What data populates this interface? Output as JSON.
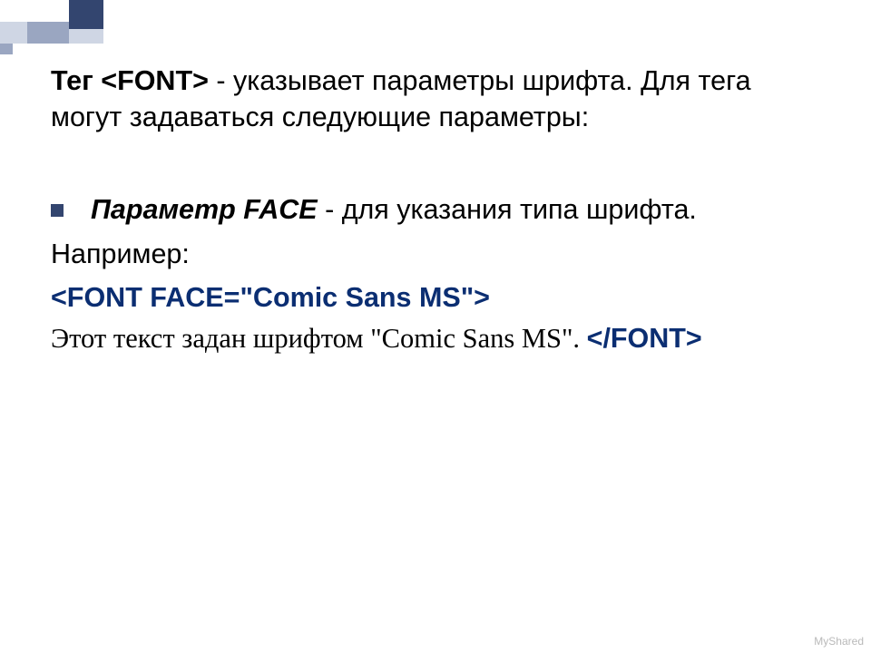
{
  "corner": {
    "dark": "#33456f",
    "mid": "#9aa6c1",
    "light": "#cfd6e4"
  },
  "paragraph1": {
    "prefix": "Тег ",
    "tag": "<FONT>",
    "suffix": " - указывает параметры шрифта. Для тега могут задаваться следующие параметры:"
  },
  "bullet": {
    "param_label": "Параметр FACE",
    "rest": " - для указания типа шрифта."
  },
  "example_label": "Например:",
  "font_open": "<FONT FACE=\"Comic Sans MS\">",
  "comic_text": "Этот текст задан шрифтом \"Comic Sans MS\".  ",
  "font_close": "</FONT>",
  "watermark": "MyShared"
}
